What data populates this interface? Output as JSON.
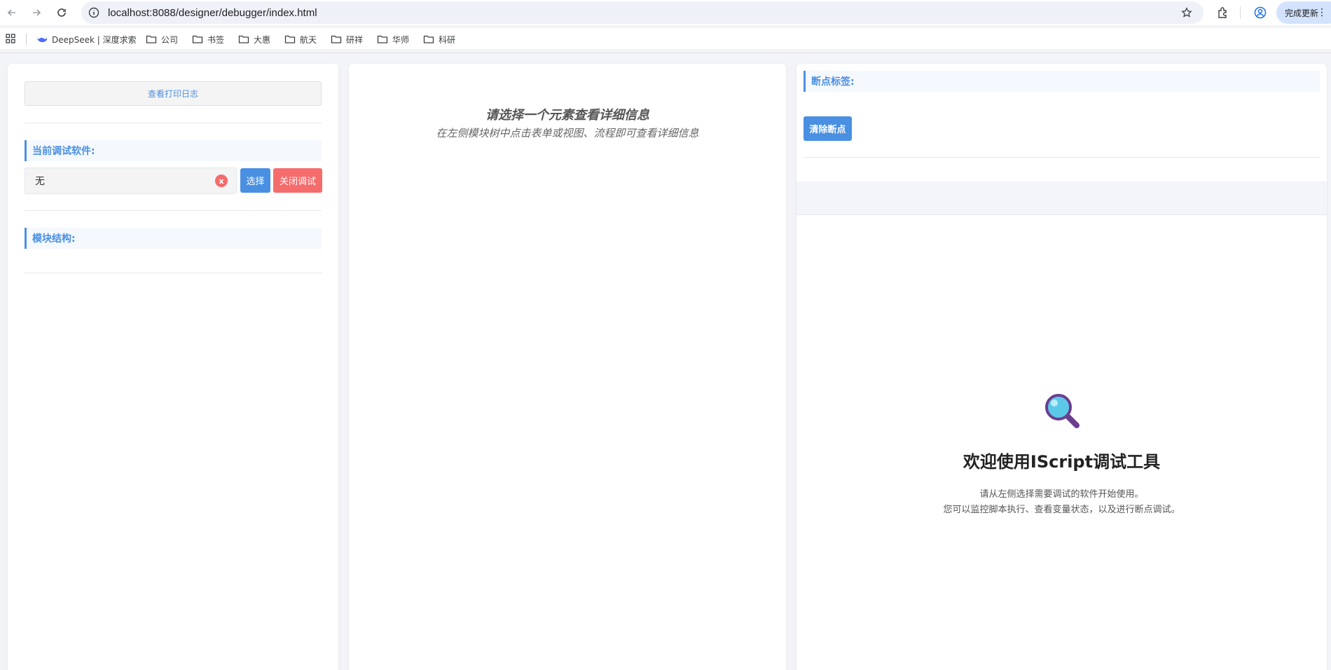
{
  "browser": {
    "url": "localhost:8088/designer/debugger/index.html",
    "update_label": "完成更新",
    "bookmarks": [
      {
        "label": "DeepSeek | 深度求索",
        "icon": "deepseek-icon"
      },
      {
        "label": "公司",
        "icon": "folder-icon"
      },
      {
        "label": "书签",
        "icon": "folder-icon"
      },
      {
        "label": "大惠",
        "icon": "folder-icon"
      },
      {
        "label": "航天",
        "icon": "folder-icon"
      },
      {
        "label": "研祥",
        "icon": "folder-icon"
      },
      {
        "label": "华师",
        "icon": "folder-icon"
      },
      {
        "label": "科研",
        "icon": "folder-icon"
      }
    ]
  },
  "left": {
    "log_button": "查看打印日志",
    "current_software_label": "当前调试软件:",
    "software_value": "无",
    "clear_icon_text": "x",
    "select_button": "选择",
    "close_debug_button": "关闭调试",
    "module_structure_label": "模块结构:"
  },
  "middle": {
    "title": "请选择一个元素查看详细信息",
    "subtitle": "在左侧模块树中点击表单或视图、流程即可查看详细信息"
  },
  "right": {
    "breakpoint_label": "断点标签:",
    "clear_breakpoints_button": "清除断点",
    "welcome_title": "欢迎使用IScript调试工具",
    "welcome_line1": "请从左侧选择需要调试的软件开始使用。",
    "welcome_line2": "您可以监控脚本执行、查看变量状态，以及进行断点调试。"
  },
  "colors": {
    "accent": "#4a90e2",
    "danger": "#f56c6c"
  }
}
